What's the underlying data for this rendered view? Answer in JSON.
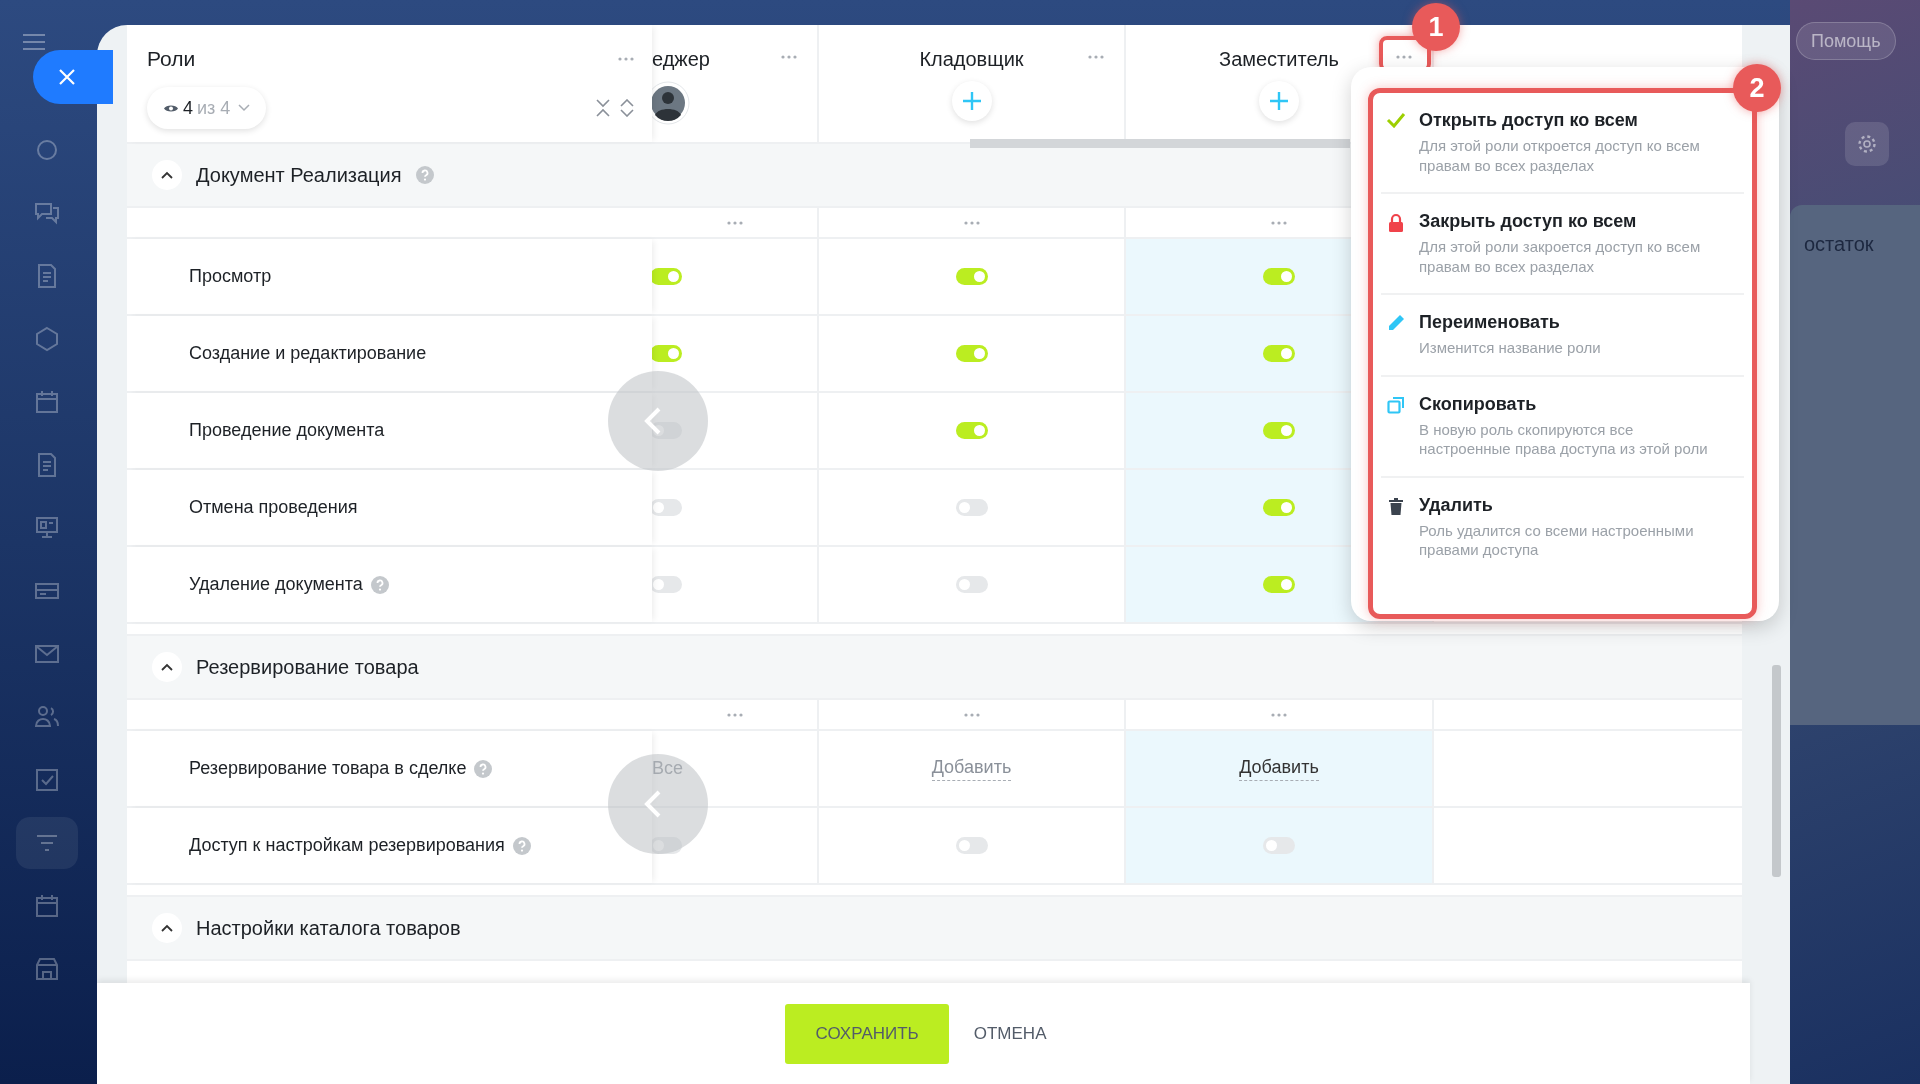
{
  "help_button": "Помощь",
  "background_card": {
    "text": "остаток"
  },
  "roles_header": {
    "title": "Роли",
    "filter": {
      "count": "4",
      "total": "из 4"
    }
  },
  "columns": [
    {
      "title": "еджер",
      "kind": "avatar",
      "selected": false
    },
    {
      "title": "Кладовщик",
      "kind": "add",
      "selected": false
    },
    {
      "title": "Заместитель",
      "kind": "add",
      "selected": true
    }
  ],
  "sections": [
    {
      "title": "Документ Реализация",
      "help": true,
      "expanded": true,
      "rows": [
        {
          "label": "Просмотр",
          "help": false,
          "cells": [
            {
              "kind": "toggle",
              "on": true
            },
            {
              "kind": "toggle",
              "on": true
            },
            {
              "kind": "toggle",
              "on": true
            }
          ]
        },
        {
          "label": "Создание и редактирование",
          "help": false,
          "cells": [
            {
              "kind": "toggle",
              "on": true
            },
            {
              "kind": "toggle",
              "on": true
            },
            {
              "kind": "toggle",
              "on": true
            }
          ]
        },
        {
          "label": "Проведение документа",
          "help": false,
          "cells": [
            {
              "kind": "toggle",
              "on": false
            },
            {
              "kind": "toggle",
              "on": true
            },
            {
              "kind": "toggle",
              "on": true
            }
          ]
        },
        {
          "label": "Отмена проведения",
          "help": false,
          "cells": [
            {
              "kind": "toggle",
              "on": false
            },
            {
              "kind": "toggle",
              "on": false
            },
            {
              "kind": "toggle",
              "on": true
            }
          ]
        },
        {
          "label": "Удаление документа",
          "help": true,
          "cells": [
            {
              "kind": "toggle",
              "on": false
            },
            {
              "kind": "toggle",
              "on": false
            },
            {
              "kind": "toggle",
              "on": true
            }
          ]
        }
      ]
    },
    {
      "title": "Резервирование товара",
      "help": false,
      "expanded": true,
      "rows": [
        {
          "label": "Резервирование товара в сделке",
          "help": true,
          "cells": [
            {
              "kind": "link",
              "text": "Все"
            },
            {
              "kind": "link",
              "text": "Добавить"
            },
            {
              "kind": "link",
              "text": "Добавить"
            }
          ]
        },
        {
          "label": "Доступ к настройкам резервирования",
          "help": true,
          "cells": [
            {
              "kind": "toggle",
              "on": false
            },
            {
              "kind": "toggle",
              "on": false
            },
            {
              "kind": "toggle",
              "on": false
            }
          ]
        }
      ]
    },
    {
      "title": "Настройки каталога товаров",
      "help": false,
      "expanded": true
    }
  ],
  "menu": {
    "items": [
      {
        "kind": "check",
        "title": "Открыть доступ ко всем",
        "description": "Для этой роли откроется доступ ко всем правам во всех разделах"
      },
      {
        "kind": "lock",
        "title": "Закрыть доступ ко всем",
        "description": "Для этой роли закроется доступ ко всем правам во всех разделах"
      },
      {
        "kind": "pencil",
        "title": "Переименовать",
        "description": "Изменится название роли"
      },
      {
        "kind": "copy",
        "title": "Скопировать",
        "description": "В новую роль скопируются все настроенные права доступа из этой роли"
      },
      {
        "kind": "trash",
        "title": "Удалить",
        "description": "Роль удалится со всеми настроенными правами доступа"
      }
    ]
  },
  "annotations": [
    "1",
    "2"
  ],
  "footer": {
    "save": "СОХРАНИТЬ",
    "cancel": "ОТМЕНА"
  }
}
